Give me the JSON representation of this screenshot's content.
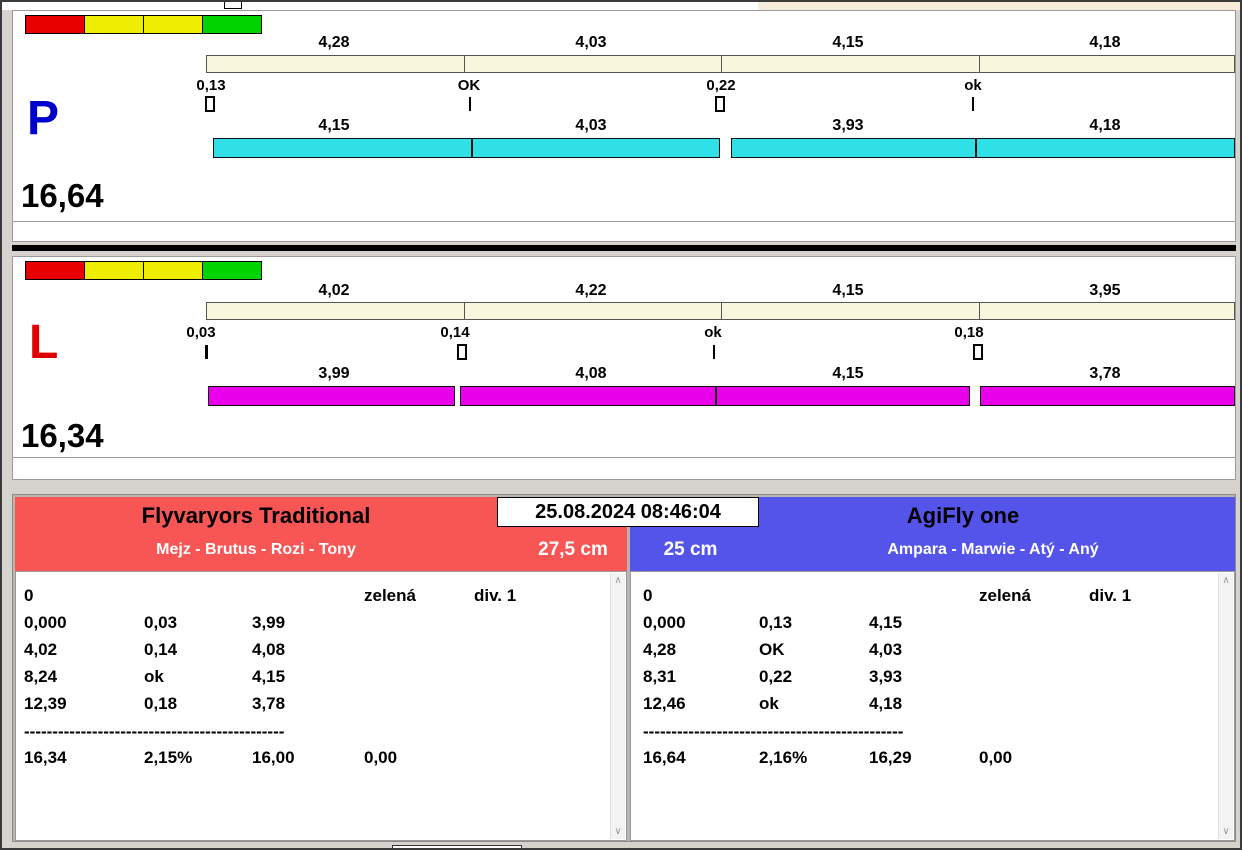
{
  "datetime": "25.08.2024 08:46:04",
  "colors": {
    "cream_bar": "#f8f6dd",
    "cyan_bar": "#2fe0e6",
    "magenta_bar": "#ea00ea",
    "left_header": "#f85555",
    "right_header": "#5454ea",
    "lane_p_letter": "#0000cd",
    "lane_l_letter": "#e00000",
    "traffic_light": [
      "#e60000",
      "#f0ee00",
      "#f0ee00",
      "#00d400"
    ]
  },
  "lane_p": {
    "label": "P",
    "total": "16,64",
    "upper_times": [
      "4,28",
      "4,03",
      "4,15",
      "4,18"
    ],
    "marks": [
      {
        "label": "0,13",
        "type": "box"
      },
      {
        "label": "OK",
        "type": "line"
      },
      {
        "label": "0,22",
        "type": "box"
      },
      {
        "label": "ok",
        "type": "line"
      }
    ],
    "lower_times": [
      "4,15",
      "4,03",
      "3,93",
      "4,18"
    ]
  },
  "lane_l": {
    "label": "L",
    "total": "16,34",
    "upper_times": [
      "4,02",
      "4,22",
      "4,15",
      "3,95"
    ],
    "marks": [
      {
        "label": "0,03",
        "type": "line"
      },
      {
        "label": "0,14",
        "type": "box"
      },
      {
        "label": "ok",
        "type": "line"
      },
      {
        "label": "0,18",
        "type": "box"
      }
    ],
    "lower_times": [
      "3,99",
      "4,08",
      "4,15",
      "3,78"
    ]
  },
  "left_team": {
    "name": "Flyvaryors Traditional",
    "members": "Mejz - Brutus - Rozi - Tony",
    "jump_height": "27,5 cm",
    "status_row": [
      "0",
      "zelená",
      "div. 1"
    ],
    "splits": [
      [
        "0,000",
        "0,03",
        "3,99"
      ],
      [
        "4,02",
        "0,14",
        "4,08"
      ],
      [
        "8,24",
        "ok",
        "4,15"
      ],
      [
        "12,39",
        "0,18",
        "3,78"
      ]
    ],
    "separator": "----------------------------------------------",
    "totals": [
      "16,34",
      "2,15%",
      "16,00",
      "0,00"
    ]
  },
  "right_team": {
    "name": "AgiFly one",
    "members": "Ampara - Marwie - Atý - Aný",
    "jump_height": "25 cm",
    "status_row": [
      "0",
      "zelená",
      "div. 1"
    ],
    "splits": [
      [
        "0,000",
        "0,13",
        "4,15"
      ],
      [
        "4,28",
        "OK",
        "4,03"
      ],
      [
        "8,31",
        "0,22",
        "3,93"
      ],
      [
        "12,46",
        "ok",
        "4,18"
      ]
    ],
    "separator": "----------------------------------------------",
    "totals": [
      "16,64",
      "2,16%",
      "16,29",
      "0,00"
    ]
  }
}
